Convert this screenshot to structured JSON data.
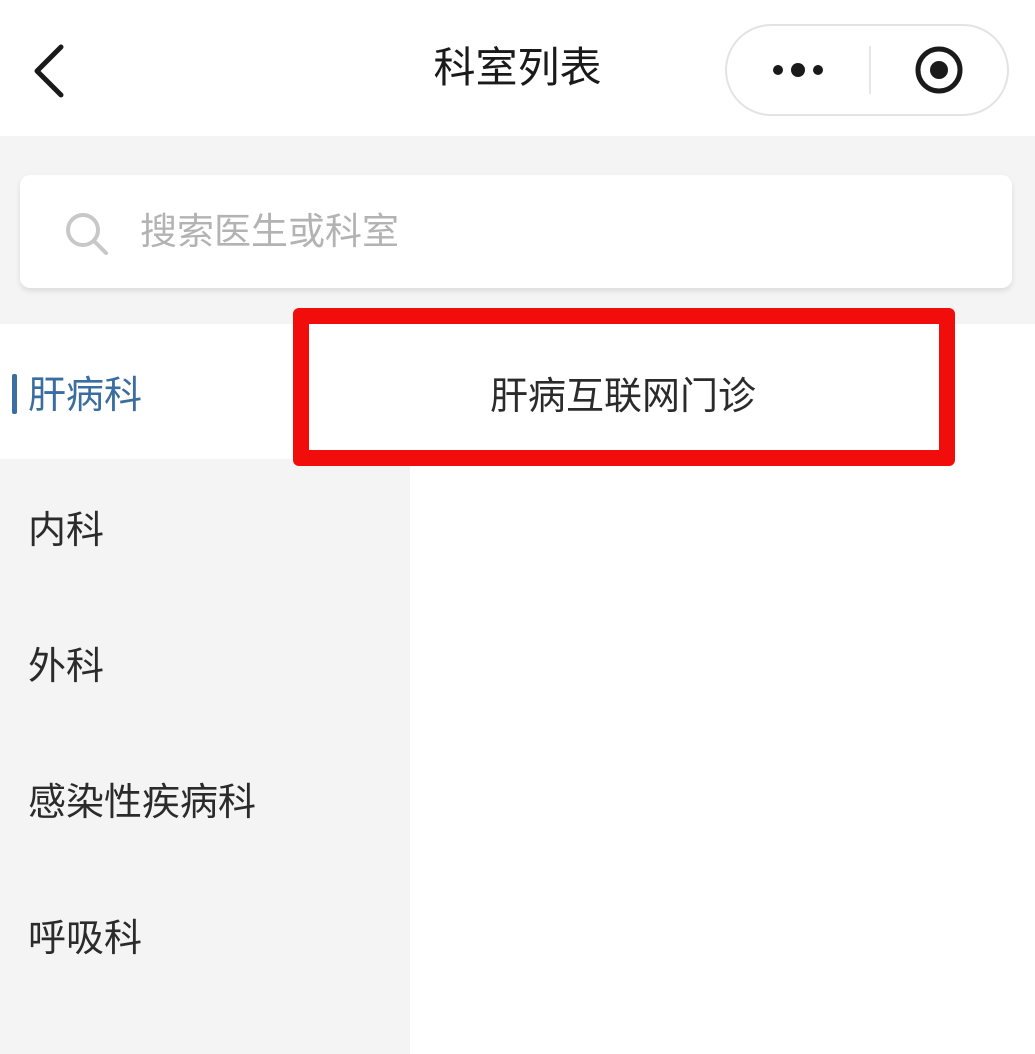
{
  "nav": {
    "title": "科室列表",
    "back_icon": "chevron-left-icon",
    "more_icon": "more-dots-icon",
    "close_icon": "target-circle-icon"
  },
  "search": {
    "placeholder": "搜索医生或科室",
    "value": "",
    "icon": "search-icon"
  },
  "sidebar": {
    "items": [
      {
        "label": "肝病科",
        "active": true
      },
      {
        "label": "内科",
        "active": false
      },
      {
        "label": "外科",
        "active": false
      },
      {
        "label": "感染性疾病科",
        "active": false
      },
      {
        "label": "呼吸科",
        "active": false
      }
    ]
  },
  "content": {
    "items": [
      {
        "label": "肝病互联网门诊"
      }
    ]
  },
  "colors": {
    "accent": "#3a6da0",
    "highlight": "#f20d0d",
    "sidebar_bg": "#f4f4f4",
    "panel_bg": "#ffffff"
  }
}
